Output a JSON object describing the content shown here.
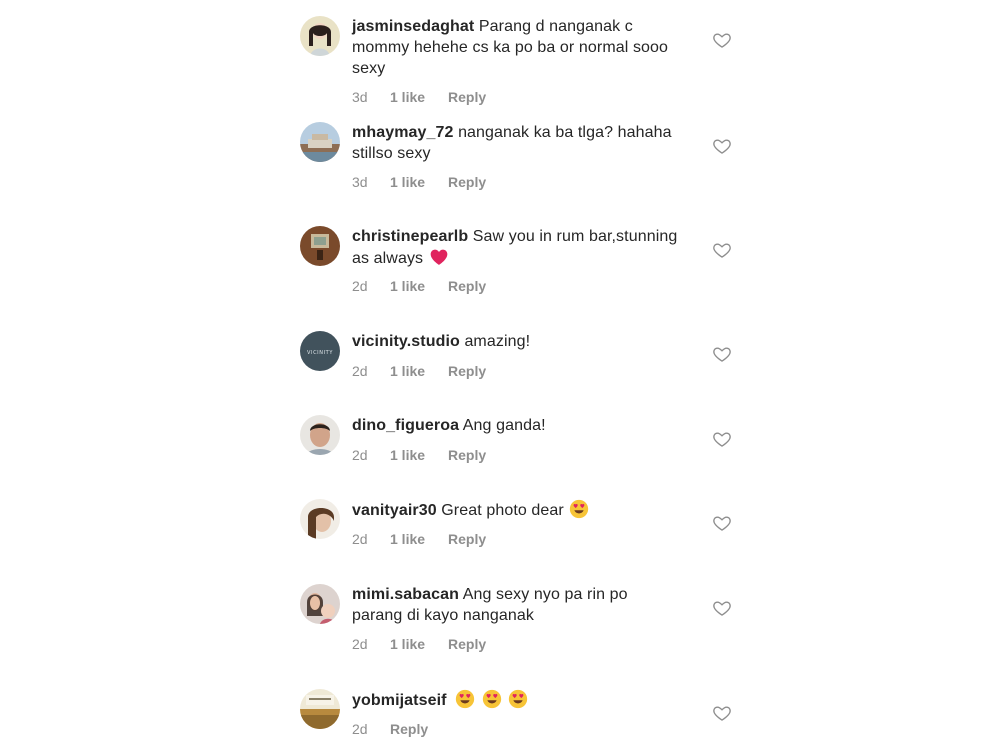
{
  "comments": [
    {
      "username": "jasminsedaghat",
      "text": "Parang d nanganak c mommy hehehe cs ka po ba or normal sooo sexy",
      "time": "3d",
      "likes": "1 like",
      "reply": "Reply"
    },
    {
      "username": "mhaymay_72",
      "text": "nanganak ka ba tlga? hahaha stillso sexy",
      "time": "3d",
      "likes": "1 like",
      "reply": "Reply"
    },
    {
      "username": "christinepearlb",
      "text": "Saw you in rum bar,stunning as always",
      "time": "2d",
      "likes": "1 like",
      "reply": "Reply"
    },
    {
      "username": "vicinity.studio",
      "text": "amazing!",
      "time": "2d",
      "likes": "1 like",
      "reply": "Reply"
    },
    {
      "username": "dino_figueroa",
      "text": "Ang ganda!",
      "time": "2d",
      "likes": "1 like",
      "reply": "Reply"
    },
    {
      "username": "vanityair30",
      "text": "Great photo dear",
      "time": "2d",
      "likes": "1 like",
      "reply": "Reply"
    },
    {
      "username": "mimi.sabacan",
      "text": "Ang sexy nyo pa rin po parang di kayo nanganak",
      "time": "2d",
      "likes": "1 like",
      "reply": "Reply"
    },
    {
      "username": "yobmijatseif",
      "text": "",
      "time": "2d",
      "likes": "",
      "reply": "Reply"
    }
  ],
  "icons": {
    "like": "heart-outline-icon",
    "red_heart": "red-heart-emoji",
    "heart_eyes": "heart-eyes-emoji"
  },
  "colors": {
    "text": "#262626",
    "meta": "#8e8e8e",
    "heart_outline": "#8e8e8e",
    "emoji_heart": "#e0245e",
    "emoji_face": "#f7c437"
  },
  "avatars": {
    "vicinity_logo_text": "VICINITY"
  }
}
